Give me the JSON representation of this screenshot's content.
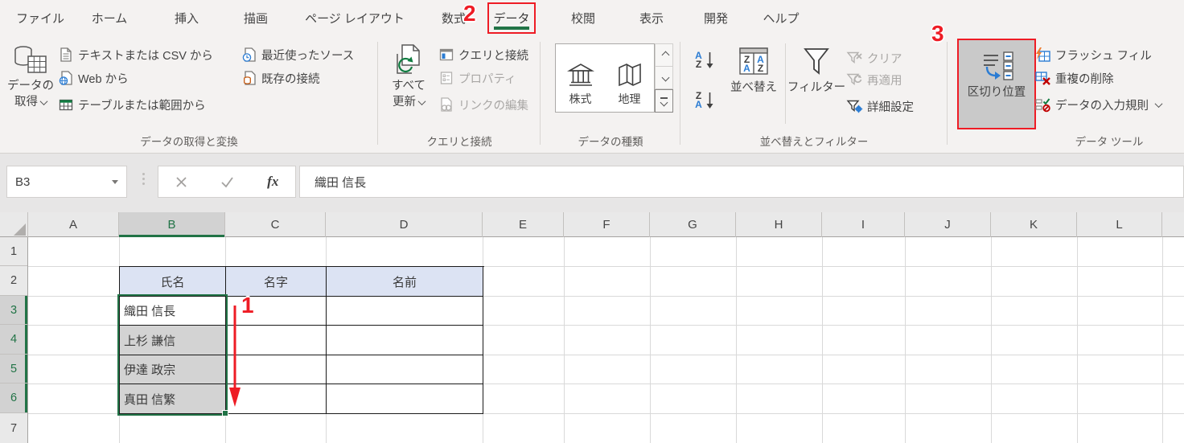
{
  "tabs": [
    "ファイル",
    "ホーム",
    "挿入",
    "描画",
    "ページ レイアウト",
    "数式",
    "データ",
    "校閲",
    "表示",
    "開発",
    "ヘルプ"
  ],
  "annotations": {
    "step1": "1",
    "step2": "2",
    "step3": "3"
  },
  "ribbon": {
    "get_transform": {
      "label": "データの取得と変換",
      "get_data_line1": "データの",
      "get_data_line2": "取得",
      "text_csv": "テキストまたは CSV から",
      "web": "Web から",
      "table_range": "テーブルまたは範囲から",
      "recent_sources": "最近使ったソース",
      "existing_connections": "既存の接続"
    },
    "queries": {
      "label": "クエリと接続",
      "refresh_line1": "すべて",
      "refresh_line2": "更新",
      "queries": "クエリと接続",
      "properties": "プロパティ",
      "edit_links": "リンクの編集"
    },
    "data_types": {
      "label": "データの種類",
      "stocks": "株式",
      "geography": "地理"
    },
    "sort_filter": {
      "label": "並べ替えとフィルター",
      "sort": "並べ替え",
      "filter": "フィルター",
      "clear": "クリア",
      "reapply": "再適用",
      "advanced": "詳細設定"
    },
    "data_tools": {
      "label": "データ ツール",
      "text_to_columns": "区切り位置",
      "flash_fill": "フラッシュ フィル",
      "remove_duplicates": "重複の削除",
      "data_validation": "データの入力規則"
    }
  },
  "formula_bar": {
    "name_box": "B3",
    "fx_label": "fx",
    "value": "織田 信長"
  },
  "sheet": {
    "columns": [
      "A",
      "B",
      "C",
      "D",
      "E",
      "F",
      "G",
      "H",
      "I",
      "J",
      "K",
      "L"
    ],
    "rows": [
      "1",
      "2",
      "3",
      "4",
      "5",
      "6",
      "7"
    ],
    "active_cell": "B3",
    "selected_range": "B3:B6",
    "table": {
      "headers": [
        "氏名",
        "名字",
        "名前"
      ],
      "names": [
        "織田 信長",
        "上杉 謙信",
        "伊達 政宗",
        "真田 信繁"
      ]
    }
  },
  "colors": {
    "excel_green": "#217346",
    "annotation_red": "#EE1C25",
    "table_header_fill": "#DCE3F3",
    "selection_fill": "#D3D3D3",
    "disabled_text": "#A9A7A5"
  }
}
